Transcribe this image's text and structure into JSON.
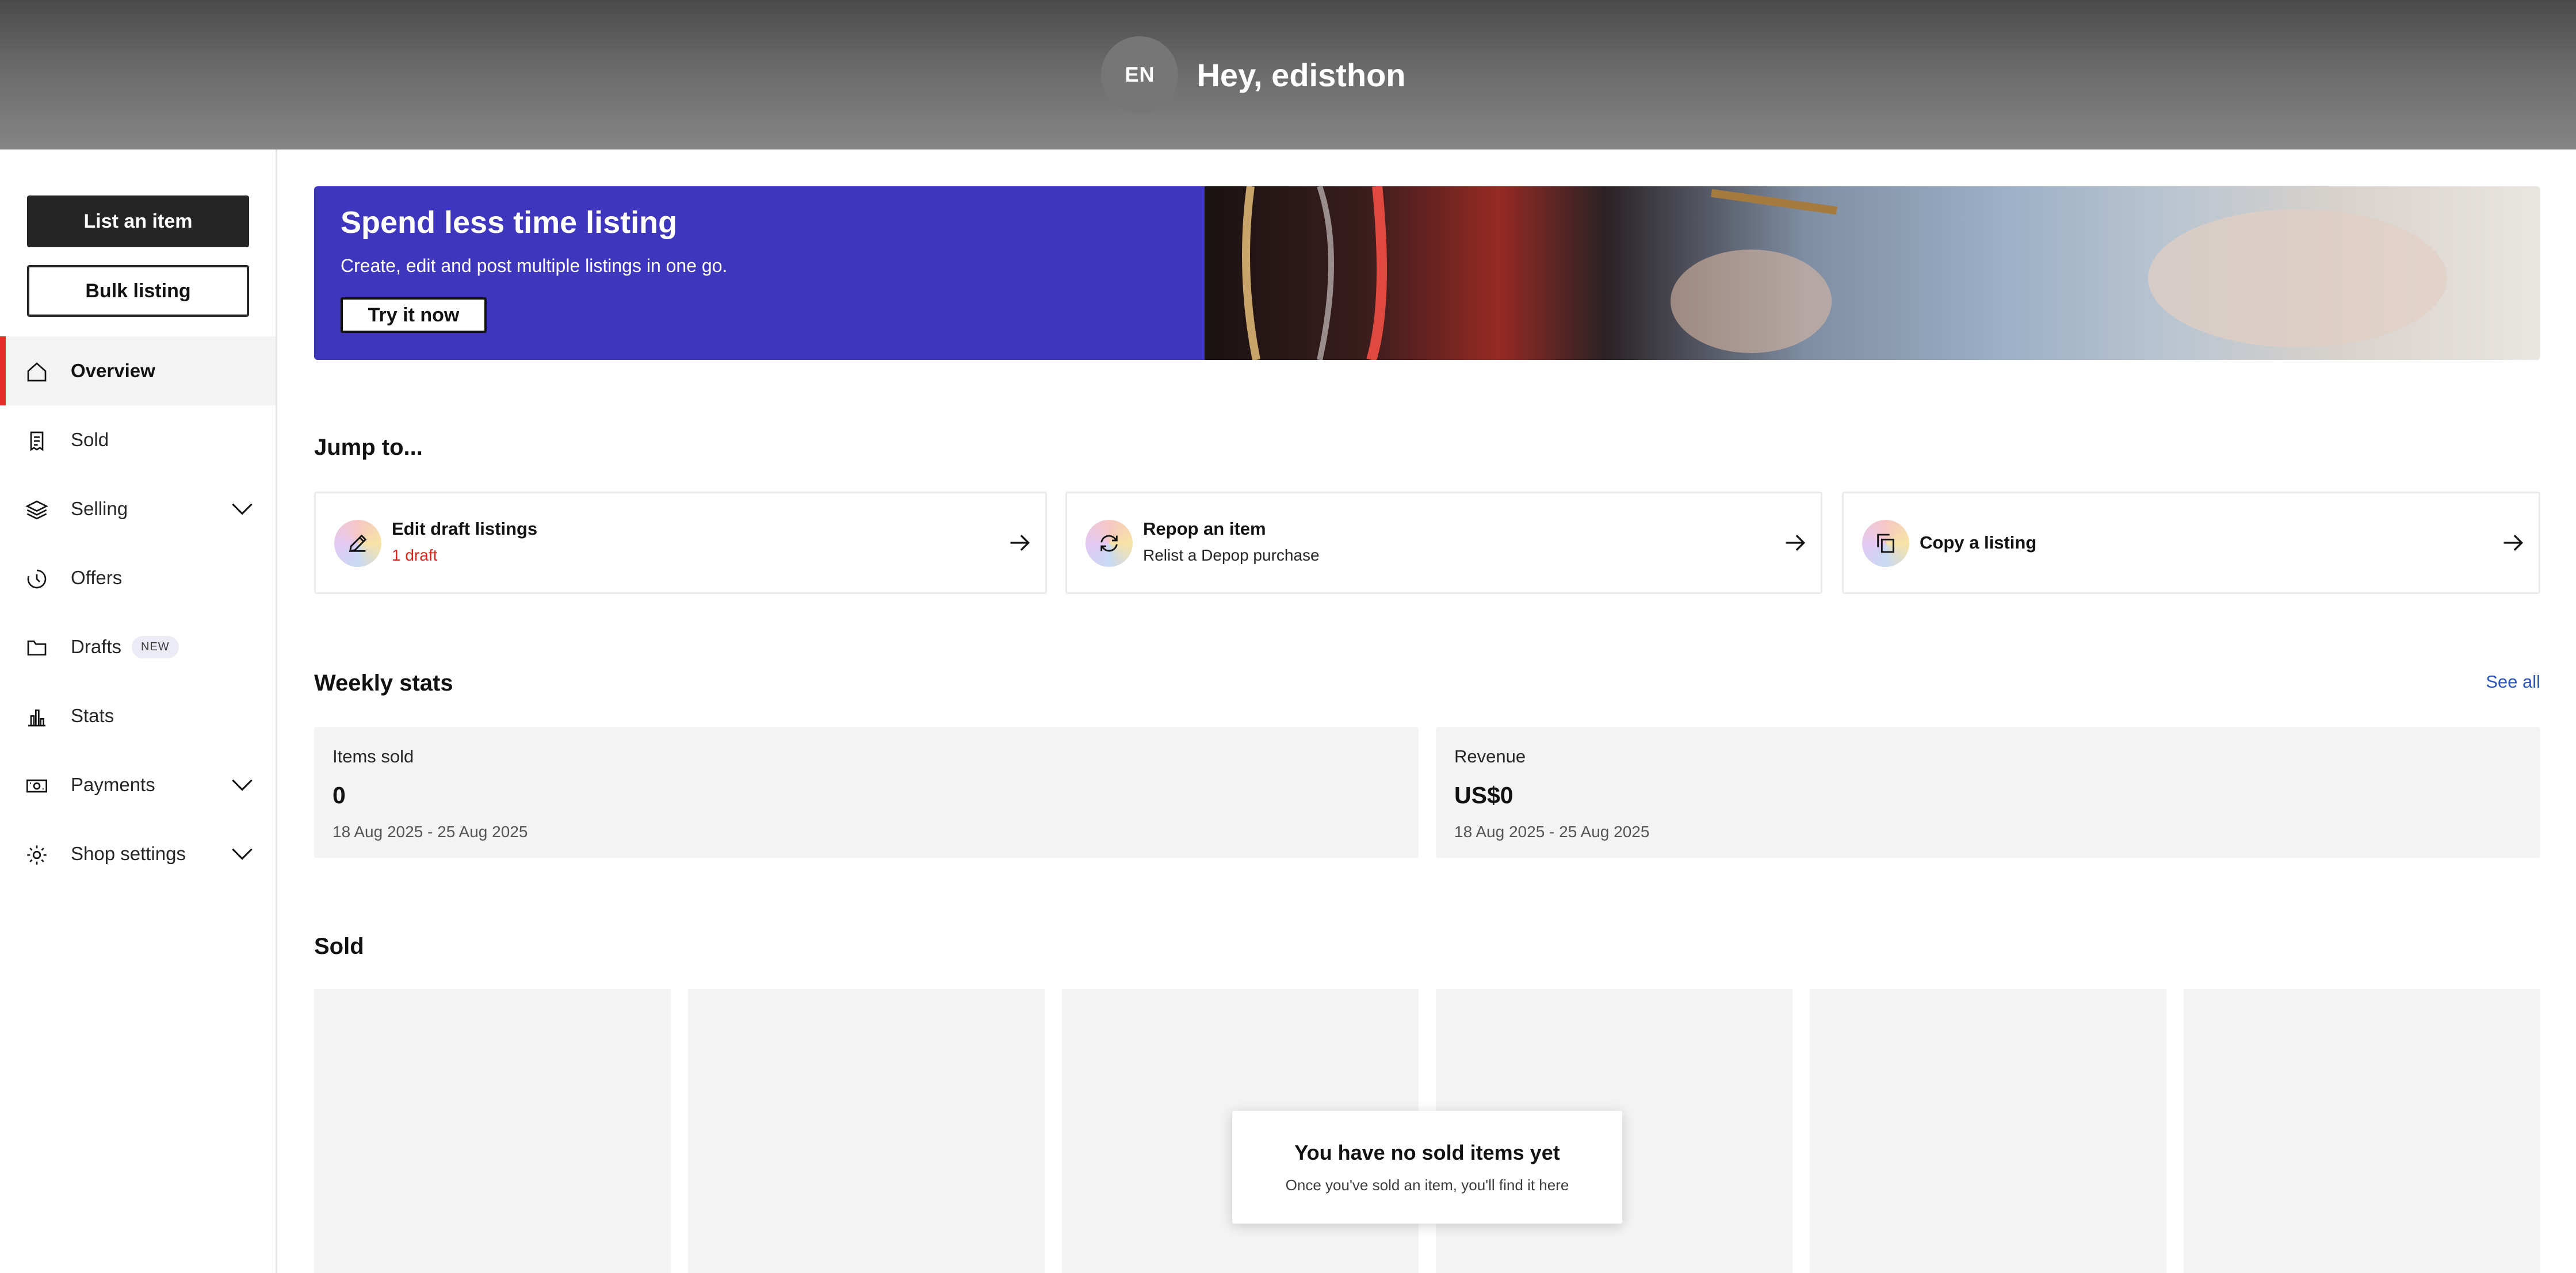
{
  "header": {
    "avatar_initials": "EN",
    "greeting": "Hey, edisthon"
  },
  "sidebar": {
    "list_item_label": "List an item",
    "bulk_listing_label": "Bulk listing",
    "items": [
      {
        "label": "Overview",
        "icon": "home-icon",
        "active": true
      },
      {
        "label": "Sold",
        "icon": "receipt-icon"
      },
      {
        "label": "Selling",
        "icon": "layers-icon",
        "expandable": true
      },
      {
        "label": "Offers",
        "icon": "offers-icon"
      },
      {
        "label": "Drafts",
        "icon": "folder-icon",
        "badge": "NEW"
      },
      {
        "label": "Stats",
        "icon": "bar-chart-icon"
      },
      {
        "label": "Payments",
        "icon": "cash-icon",
        "expandable": true
      },
      {
        "label": "Shop settings",
        "icon": "gear-icon",
        "expandable": true
      }
    ]
  },
  "banner": {
    "title": "Spend less time listing",
    "subtitle": "Create, edit and post multiple listings in one go.",
    "button_label": "Try it now",
    "background_color": "#3e36bd"
  },
  "jump_to": {
    "title": "Jump to...",
    "cards": [
      {
        "title": "Edit draft listings",
        "subtitle": "1 draft",
        "icon": "pencil-icon"
      },
      {
        "title": "Repop an item",
        "subtitle": "Relist a Depop purchase",
        "icon": "refresh-icon"
      },
      {
        "title": "Copy a listing",
        "subtitle": "",
        "icon": "copy-icon"
      }
    ]
  },
  "weekly_stats": {
    "title": "Weekly stats",
    "see_all_label": "See all",
    "items_sold": {
      "label": "Items sold",
      "value": "0",
      "date_range": "18 Aug 2025 - 25 Aug 2025"
    },
    "revenue": {
      "label": "Revenue",
      "value": "US$0",
      "date_range": "18 Aug 2025 - 25 Aug 2025"
    }
  },
  "sold": {
    "title": "Sold",
    "empty_title": "You have no sold items yet",
    "empty_subtitle": "Once you've sold an item, you'll find it here"
  },
  "colors": {
    "accent_red": "#e32f28",
    "link_blue": "#2b55b8",
    "draft_red": "#d8261e"
  }
}
